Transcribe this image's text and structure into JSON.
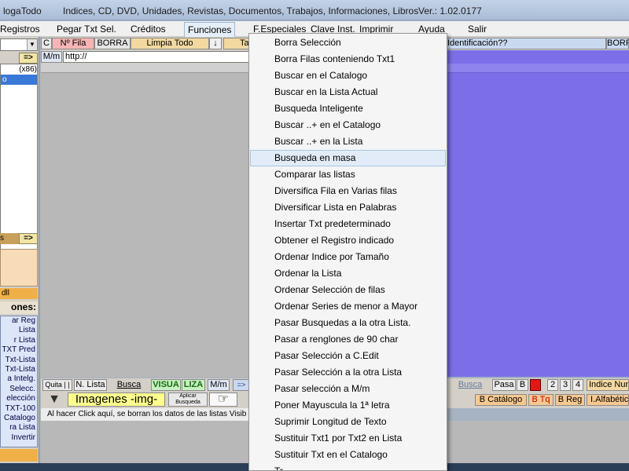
{
  "window": {
    "title": "logaTodo",
    "subtitle": "Indices,  CD, DVD, Unidades, Revistas, Documentos, Trabajos, Informaciones, Libros",
    "version": "Ver.: 1.02.0177"
  },
  "menubar": {
    "items": [
      "Registros",
      "Pegar Txt Sel.",
      "Créditos",
      "Funciones",
      "F.Especiales",
      "Clave Inst.",
      "Imprimir",
      "Ayuda",
      "Salir"
    ]
  },
  "toolbar1": {
    "c_label": "C",
    "nfila": "Nº Fila",
    "borra": "BORRA",
    "limpia": "Limpia Todo",
    "down_arrow": "↓",
    "ta": "Ta",
    "identificacion": "Identificación??",
    "borra2": "BORR"
  },
  "toolbar2": {
    "mm": "M/m",
    "url": "http://"
  },
  "left": {
    "arrow1": "=>",
    "list_rows": [
      "(x86)",
      "o"
    ],
    "section_header": "s",
    "arrow2": "=>",
    "orange_label": "dll",
    "functions_title": "ones:",
    "function_rows": [
      "ar     Reg",
      "Lista",
      "r     Lista",
      "TXT Pred",
      "Txt-Lista",
      "Txt-Lista",
      "a Intelg.",
      "Selecc.",
      "elección",
      "TXT-100",
      "Catalogo",
      "ra  Lista",
      "Invertir"
    ]
  },
  "bottom1": {
    "quita": "Quita | |",
    "nlista": "N. Lista",
    "busca": "Busca",
    "visua": "VISUA",
    "liza": "LIZA",
    "mm": "M/m",
    "arrow": "=>",
    "busca2": "Busca",
    "pasa": "Pasa",
    "b": "B",
    "n2": "2",
    "n3": "3",
    "n4": "4",
    "indice_num": "Indice Num"
  },
  "bottom2": {
    "down_tri": "▼",
    "imagenes": "Imagenes  -img-",
    "aplicar": "Aplicar",
    "busqueda": "Busqueda",
    "hand": "☞",
    "bcatalogo": "B Catálogo",
    "btq": "B Tq",
    "breg": "B Reg",
    "ialfabetico": "I.Alfabético"
  },
  "infobar": {
    "text": "Al hacer Click aquí, se borran los datos de las listas Visib"
  },
  "dropdown": {
    "highlighted_index": 7,
    "items": [
      "Borra Selección",
      "Borra Filas conteniendo Txt1",
      "Buscar en el Catalogo",
      "Buscar en la Lista Actual",
      "Busqueda Inteligente",
      "Buscar ..+ en el Catalogo",
      "Buscar ..+ en la Lista",
      "Busqueda en masa",
      "Comparar las listas",
      "Diversifica Fila en Varias filas",
      "Diversificar Lista en Palabras",
      "Insertar Txt predeterminado",
      "Obtener el Registro indicado",
      "Ordenar Indice por Tamaño",
      "Ordenar la Lista",
      "Ordenar Selección de filas",
      "Ordenar Series de menor a Mayor",
      "Pasar Busquedas a la otra Lista.",
      "Pasar a renglones de 90 char",
      "Pasar Selección a C.Edit",
      "Pasar Selección a la otra Lista",
      "Pasar selección a M/m",
      "Poner Mayuscula la 1ª letra",
      "Suprimir Longitud de Texto",
      "Sustituir Txt1 por Txt2 en Lista",
      "Sustituir Txt en el Catalogo",
      "Tr..."
    ]
  },
  "colors": {
    "accent_blue": "#7b6ee6",
    "selection": "#3a78d8",
    "menu_highlight": "#e2ecf8"
  }
}
